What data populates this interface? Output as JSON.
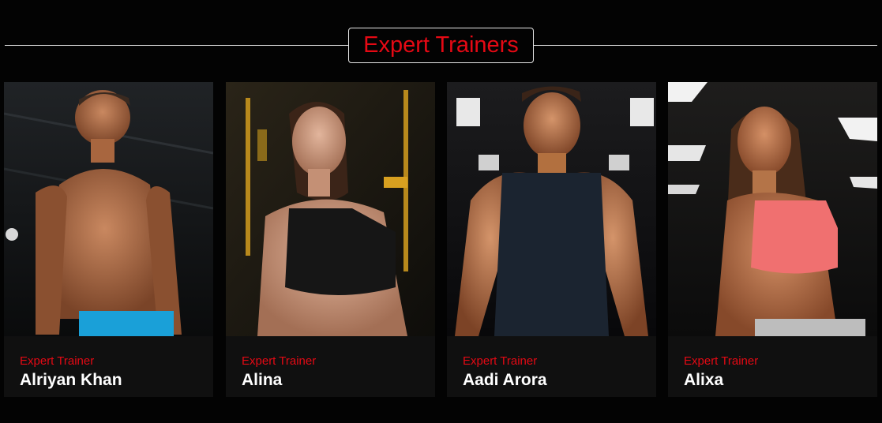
{
  "section": {
    "title": "Expert Trainers"
  },
  "trainers": [
    {
      "role": "Expert Trainer",
      "name": "Alriyan Khan",
      "photo_icon": "male-trainer-photo",
      "outfit_color": "#1aa0d8"
    },
    {
      "role": "Expert Trainer",
      "name": "Alina",
      "photo_icon": "female-trainer-photo",
      "outfit_color": "#161616"
    },
    {
      "role": "Expert Trainer",
      "name": "Aadi Arora",
      "photo_icon": "male-trainer-photo",
      "outfit_color": "#1b2430"
    },
    {
      "role": "Expert Trainer",
      "name": "Alixa",
      "photo_icon": "female-trainer-photo",
      "outfit_color": "#f07070"
    }
  ],
  "colors": {
    "background": "#030303",
    "accent": "#e50914",
    "card": "#101010",
    "text": "#ffffff"
  }
}
